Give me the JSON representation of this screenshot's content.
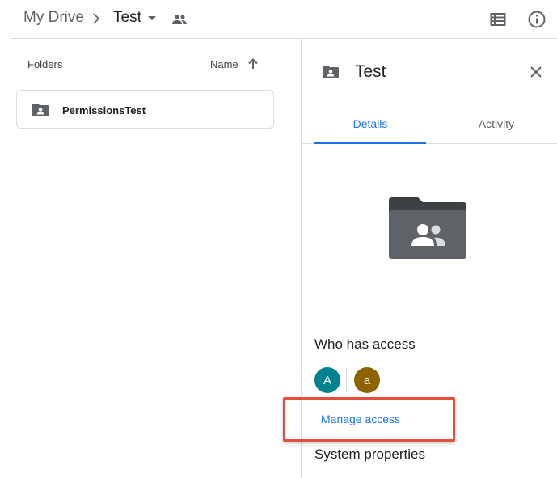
{
  "breadcrumb": {
    "root": "My Drive",
    "current": "Test"
  },
  "list": {
    "column_label": "Folders",
    "sort_label": "Name",
    "folders": [
      {
        "name": "PermissionsTest"
      }
    ]
  },
  "details": {
    "title": "Test",
    "tabs": [
      {
        "label": "Details",
        "active": true
      },
      {
        "label": "Activity",
        "active": false
      }
    ],
    "who_has_access": "Who has access",
    "avatars": [
      {
        "letter": "A",
        "color": "#00838f"
      },
      {
        "letter": "a",
        "color": "#8d6300"
      }
    ],
    "manage_access": "Manage access",
    "system_properties": "System properties"
  },
  "colors": {
    "accent": "#1a73e8",
    "highlight_box": "#e1503c",
    "folder_icon": "#5f6368"
  },
  "icons": {
    "breadcrumb_separator": "chevron-right-icon",
    "breadcrumb_dropdown": "caret-down-icon",
    "shared": "people-icon",
    "list_view": "list-view-icon",
    "info": "info-icon",
    "sort": "arrow-up-icon",
    "shared_folder": "shared-folder-icon",
    "close": "close-icon"
  }
}
